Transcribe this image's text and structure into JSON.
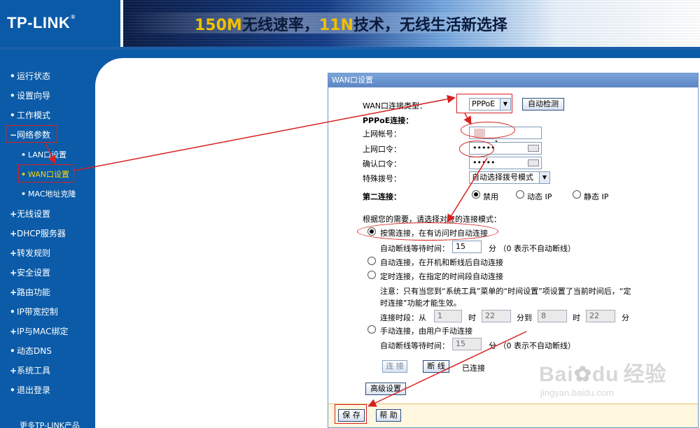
{
  "header": {
    "logo": "TP-LINK",
    "logo_mark": "®",
    "banner_part1": "150M",
    "banner_part2": "无线速率，",
    "banner_part3": "11N",
    "banner_part4": "技术，无线生活新选择"
  },
  "sidebar": {
    "items": [
      {
        "label": "运行状态"
      },
      {
        "label": "设置向导"
      },
      {
        "label": "工作模式"
      },
      {
        "label": "网络参数"
      },
      {
        "label": "LAN口设置"
      },
      {
        "label": "WAN口设置"
      },
      {
        "label": "MAC地址克隆"
      },
      {
        "label": "无线设置"
      },
      {
        "label": "DHCP服务器"
      },
      {
        "label": "转发规则"
      },
      {
        "label": "安全设置"
      },
      {
        "label": "路由功能"
      },
      {
        "label": "IP带宽控制"
      },
      {
        "label": "IP与MAC绑定"
      },
      {
        "label": "动态DNS"
      },
      {
        "label": "系统工具"
      },
      {
        "label": "退出登录"
      },
      {
        "label": "更多TP-LINK产品"
      }
    ]
  },
  "panel": {
    "title": "WAN口设置",
    "wan_type_label": "WAN口连接类型：",
    "wan_type_value": "PPPoE",
    "auto_detect": "自动检测",
    "pppoe_label": "PPPoE连接：",
    "account_label": "上网帐号：",
    "account_value": "1",
    "password_label": "上网口令：",
    "password_value": "•••••",
    "confirm_label": "确认口令：",
    "confirm_value": "•••••",
    "special_dial_label": "特殊拨号：",
    "special_dial_value": "自动选择拨号模式",
    "second_conn_label": "第二连接：",
    "second_opts": [
      "禁用",
      "动态 IP",
      "静态 IP"
    ],
    "mode_prompt": "根据您的需要，请选择对应的连接模式：",
    "mode_demand": "按需连接，在有访问时自动连接",
    "idle_label": "自动断线等待时间：",
    "idle_value": "15",
    "idle_unit": "分 （0 表示不自动断线）",
    "mode_auto": "自动连接，在开机和断线后自动连接",
    "mode_timed": "定时连接，在指定的时间段自动连接",
    "note_line1": "注意：只有当您到“系统工具”菜单的“时间设置”项设置了当前时间后，“定",
    "note_line2": "时连接”功能才能生效。",
    "period_label": "连接时段：从",
    "period_h1": "1",
    "period_m1": "22",
    "period_h2": "8",
    "period_m2": "22",
    "hour": "时",
    "min_to": "分到",
    "min": "分",
    "mode_manual": "手动连接，由用户手动连接",
    "idle2_value": "15",
    "connect_btn": "连 接",
    "disconnect_btn": "断 线",
    "status": "已连接",
    "advanced_btn": "高级设置",
    "save_btn": "保 存",
    "help_btn": "帮 助"
  },
  "watermark": {
    "brand": "Bai",
    "brand2": "du",
    "cn": "经验",
    "url": "jingyan.baidu.com"
  },
  "colors": {
    "sidebar": "#0b5ba8",
    "annotation": "#d82020",
    "panel_title": "#5b86c3"
  }
}
